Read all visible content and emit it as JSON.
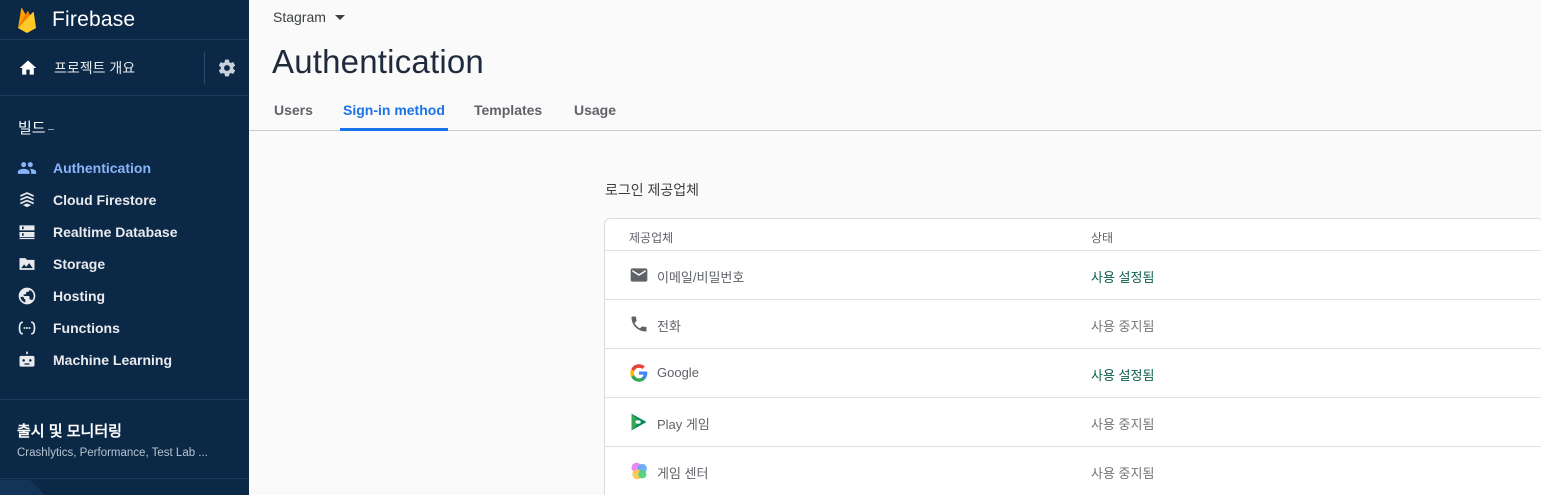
{
  "brand": {
    "name": "Firebase"
  },
  "overview": {
    "label": "프로젝트 개요"
  },
  "build": {
    "title": "빌드",
    "items": [
      {
        "label": "Authentication",
        "icon": "people-icon",
        "active": true
      },
      {
        "label": "Cloud Firestore",
        "icon": "firestore-icon"
      },
      {
        "label": "Realtime Database",
        "icon": "database-icon"
      },
      {
        "label": "Storage",
        "icon": "storage-icon"
      },
      {
        "label": "Hosting",
        "icon": "globe-icon"
      },
      {
        "label": "Functions",
        "icon": "functions-icon"
      },
      {
        "label": "Machine Learning",
        "icon": "robot-icon"
      }
    ]
  },
  "release": {
    "title": "출시 및 모니터링",
    "subtitle": "Crashlytics, Performance, Test Lab ..."
  },
  "header": {
    "project": "Stagram",
    "title": "Authentication",
    "tabs": [
      {
        "label": "Users"
      },
      {
        "label": "Sign-in method",
        "active": true
      },
      {
        "label": "Templates"
      },
      {
        "label": "Usage"
      }
    ]
  },
  "providers": {
    "title": "로그인 제공업체",
    "col_provider": "제공업체",
    "col_status": "상태",
    "rows": [
      {
        "name": "이메일/비밀번호",
        "status": "사용 설정됨",
        "enabled": true,
        "icon": "mail-icon"
      },
      {
        "name": "전화",
        "status": "사용 중지됨",
        "enabled": false,
        "icon": "phone-icon"
      },
      {
        "name": "Google",
        "status": "사용 설정됨",
        "enabled": true,
        "icon": "google-icon"
      },
      {
        "name": "Play 게임",
        "status": "사용 중지됨",
        "enabled": false,
        "icon": "play-games-icon"
      },
      {
        "name": "게임 센터",
        "status": "사용 중지됨",
        "enabled": false,
        "icon": "game-center-icon"
      }
    ]
  },
  "colors": {
    "sidebar_bg": "#0b2847",
    "accent": "#1a73e8",
    "active_nav": "#8ab4f8",
    "enabled_status": "#0b5d4a"
  }
}
